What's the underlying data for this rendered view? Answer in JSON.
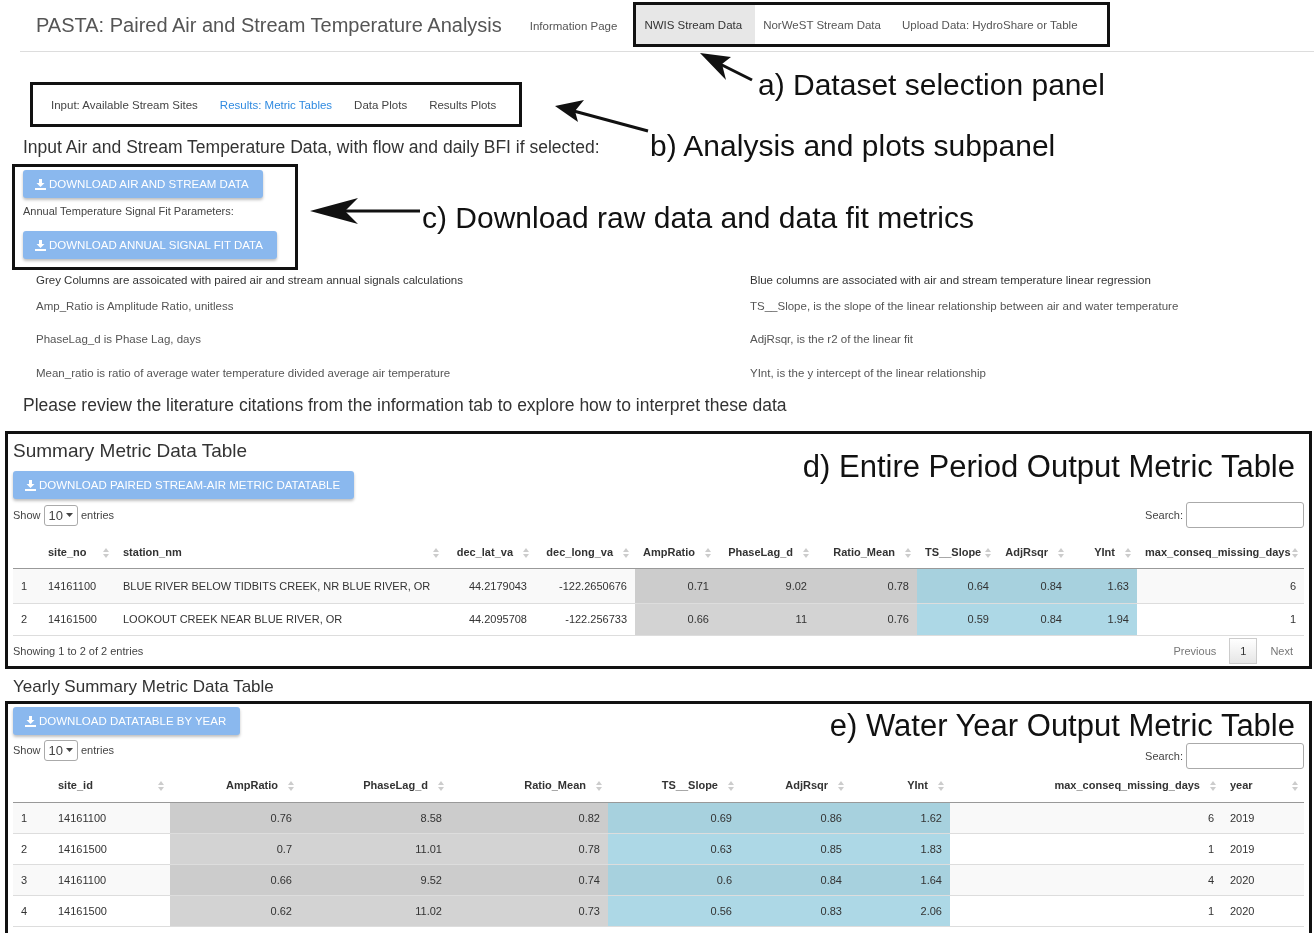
{
  "navbar": {
    "title": "PASTA: Paired Air and Stream Temperature Analysis",
    "annotation": "a) Dataset selection panel",
    "tabs": [
      {
        "label": "Information Page",
        "selected": false,
        "framed": false
      },
      {
        "label": "NWIS Stream Data",
        "selected": true,
        "framed": true
      },
      {
        "label": "NorWeST Stream Data",
        "selected": false,
        "framed": true
      },
      {
        "label": "Upload Data: HydroShare or Table",
        "selected": false,
        "framed": true
      }
    ]
  },
  "subtabs": {
    "annotation": "b) Analysis and plots subpanel",
    "tabs": [
      {
        "label": "Input: Available Stream Sites",
        "selected": false
      },
      {
        "label": "Results: Metric Tables",
        "selected": true
      },
      {
        "label": "Data Plots",
        "selected": false
      },
      {
        "label": "Results Plots",
        "selected": false
      }
    ]
  },
  "input_heading": "Input Air and Stream Temperature Data, with flow and daily BFI if selected:",
  "downloads": {
    "annotation": "c) Download raw data and data fit metrics",
    "items": [
      {
        "kind": "button",
        "label": "DOWNLOAD AIR AND STREAM DATA"
      },
      {
        "kind": "label",
        "label": "Annual Temperature Signal Fit Parameters:"
      },
      {
        "kind": "button",
        "label": "DOWNLOAD ANNUAL SIGNAL FIT DATA"
      }
    ]
  },
  "notes": [
    {
      "left": "Grey Columns are assoicated with paired air and stream annual signals calculations",
      "right": "Blue columns are associated with air and stream temperature linear regression",
      "emphasis": true
    },
    {
      "left": "Amp_Ratio is Amplitude Ratio, unitless",
      "right": "TS__Slope, is the slope of the linear relationship between air and water temperature",
      "emphasis": false
    },
    {
      "left": "PhaseLag_d is Phase Lag, days",
      "right": "AdjRsqr, is the r2 of the linear fit",
      "emphasis": false
    },
    {
      "left": "Mean_ratio is ratio of average water temperature divided average air temperature",
      "right": "YInt, is the y intercept of the linear relationship",
      "emphasis": false
    }
  ],
  "review_text": "Please review the literature citations from the information tab to explore how to interpret these data",
  "summary_table": {
    "title": "Summary Metric Data Table",
    "annotation": "d) Entire Period Output Metric Table",
    "download_label": "DOWNLOAD PAIRED STREAM-AIR METRIC DATATABLE",
    "show_label": "Show",
    "page_size": "10",
    "entries_label": "entries",
    "search_label": "Search:",
    "columns": [
      {
        "kind": "index"
      },
      {
        "label": "site_no",
        "kind": "text"
      },
      {
        "label": "station_nm",
        "kind": "text"
      },
      {
        "label": "dec_lat_va",
        "kind": "number"
      },
      {
        "label": "dec_long_va",
        "kind": "number"
      },
      {
        "label": "AmpRatio",
        "kind": "number",
        "color": "#d3d3d3"
      },
      {
        "label": "PhaseLag_d",
        "kind": "number",
        "color": "#d3d3d3"
      },
      {
        "label": "Ratio_Mean",
        "kind": "number",
        "color": "#d3d3d3"
      },
      {
        "label": "TS__Slope",
        "kind": "number",
        "color": "#add8e6"
      },
      {
        "label": "AdjRsqr",
        "kind": "number",
        "color": "#add8e6"
      },
      {
        "label": "YInt",
        "kind": "number",
        "color": "#add8e6"
      },
      {
        "label": "max_conseq_missing_days",
        "kind": "number"
      }
    ],
    "rows": [
      [
        "1",
        "14161100",
        "BLUE RIVER BELOW TIDBITS CREEK, NR BLUE RIVER, OR",
        "44.2179043",
        "-122.2650676",
        "0.71",
        "9.02",
        "0.78",
        "0.64",
        "0.84",
        "1.63",
        "6"
      ],
      [
        "2",
        "14161500",
        "LOOKOUT CREEK NEAR BLUE RIVER, OR",
        "44.2095708",
        "-122.256733",
        "0.66",
        "11",
        "0.76",
        "0.59",
        "0.84",
        "1.94",
        "1"
      ]
    ],
    "info": "Showing 1 to 2 of 2 entries",
    "pagination": [
      {
        "label": "Previous",
        "kind": "link",
        "selected": false
      },
      {
        "label": "1",
        "kind": "page",
        "selected": true
      },
      {
        "label": "Next",
        "kind": "link",
        "selected": false
      }
    ]
  },
  "yearly_title": "Yearly Summary Metric Data Table",
  "yearly_table": {
    "annotation": "e) Water Year Output Metric Table",
    "download_label": "DOWNLOAD DATATABLE BY YEAR",
    "show_label": "Show",
    "page_size": "10",
    "entries_label": "entries",
    "search_label": "Search:",
    "columns": [
      {
        "kind": "index"
      },
      {
        "label": "site_id",
        "kind": "text"
      },
      {
        "label": "AmpRatio",
        "kind": "number",
        "color": "#d3d3d3"
      },
      {
        "label": "PhaseLag_d",
        "kind": "number",
        "color": "#d3d3d3"
      },
      {
        "label": "Ratio_Mean",
        "kind": "number",
        "color": "#d3d3d3"
      },
      {
        "label": "TS__Slope",
        "kind": "number",
        "color": "#add8e6"
      },
      {
        "label": "AdjRsqr",
        "kind": "number",
        "color": "#add8e6"
      },
      {
        "label": "YInt",
        "kind": "number",
        "color": "#add8e6"
      },
      {
        "label": "max_conseq_missing_days",
        "kind": "number"
      },
      {
        "label": "year",
        "kind": "text"
      }
    ],
    "rows": [
      [
        "1",
        "14161100",
        "0.76",
        "8.58",
        "0.82",
        "0.69",
        "0.86",
        "1.62",
        "6",
        "2019"
      ],
      [
        "2",
        "14161500",
        "0.7",
        "11.01",
        "0.78",
        "0.63",
        "0.85",
        "1.83",
        "1",
        "2019"
      ],
      [
        "3",
        "14161100",
        "0.66",
        "9.52",
        "0.74",
        "0.6",
        "0.84",
        "1.64",
        "4",
        "2020"
      ],
      [
        "4",
        "14161500",
        "0.62",
        "11.02",
        "0.73",
        "0.56",
        "0.83",
        "2.06",
        "1",
        "2020"
      ]
    ]
  }
}
